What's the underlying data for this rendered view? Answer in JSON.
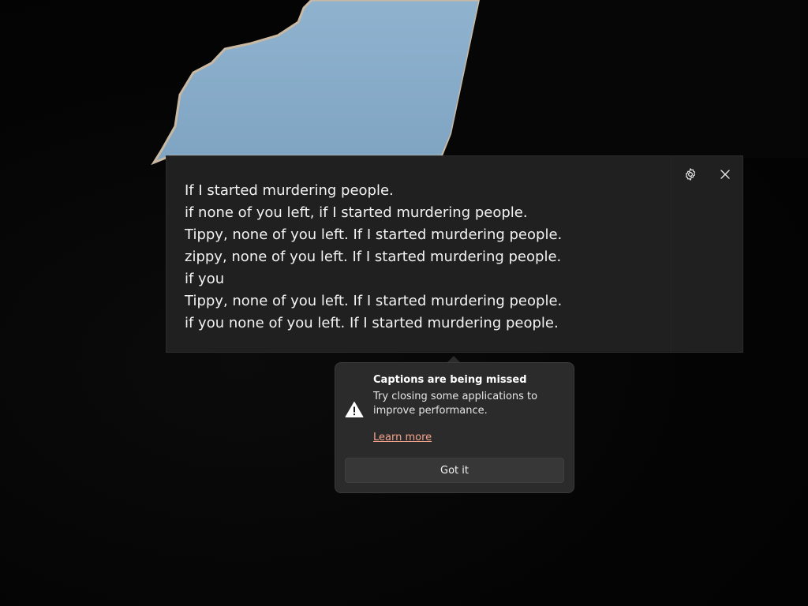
{
  "captions": {
    "lines": [
      "If I started murdering people.",
      "if none of you left, if I started murdering people.",
      "Tippy, none of you left. If I started murdering people.",
      "zippy, none of you left. If I started murdering people.",
      "if you",
      "Tippy, none of you left. If I started murdering people.",
      "if you none of you left. If I started murdering people."
    ],
    "settings_icon": "gear-icon",
    "close_icon": "close-icon"
  },
  "notification": {
    "icon": "warning-icon",
    "title": "Captions are being missed",
    "body": "Try closing some applications to improve performance.",
    "link": "Learn more",
    "button": "Got it",
    "link_color": "#f4a48c"
  },
  "colors": {
    "caption_window_bg": "#202020",
    "flyout_bg": "#2b2b2b",
    "caption_text": "#f2f2f2"
  }
}
